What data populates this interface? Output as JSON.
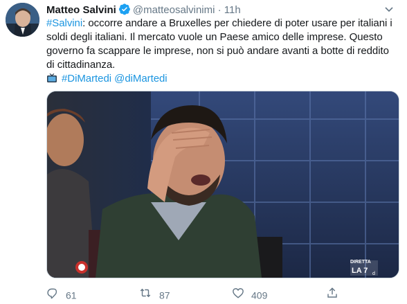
{
  "author": {
    "name": "Matteo Salvini",
    "handle": "@matteosalvinimi",
    "separator": "·",
    "time": "11h"
  },
  "tweet": {
    "lines": [
      {
        "hashtag": "#Salvini",
        "rest": ": occorre andare a Bruxelles per chiedere di poter usare per italiani i"
      },
      {
        "text": "soldi degli italiani. Il mercato vuole un Paese amico delle imprese. Questo"
      },
      {
        "text": "governo fa scappare le imprese, non si può andare avanti a botte di reddito"
      },
      {
        "text": "di cittadinanza."
      }
    ],
    "tags_line": "#DiMartedi @diMartedi"
  },
  "media": {
    "watermark_brand": "DIRETTA",
    "watermark_channel": "LA 7",
    "watermark_suffix": "d"
  },
  "actions": {
    "replies": "61",
    "retweets": "87",
    "likes": "409"
  },
  "colors": {
    "link": "#1b95e0",
    "verified": "#1da1f2",
    "muted": "#657786"
  },
  "icons": [
    "verified-badge-icon",
    "chevron-down-icon",
    "tv-icon",
    "reply-icon",
    "retweet-icon",
    "like-icon",
    "share-icon"
  ]
}
